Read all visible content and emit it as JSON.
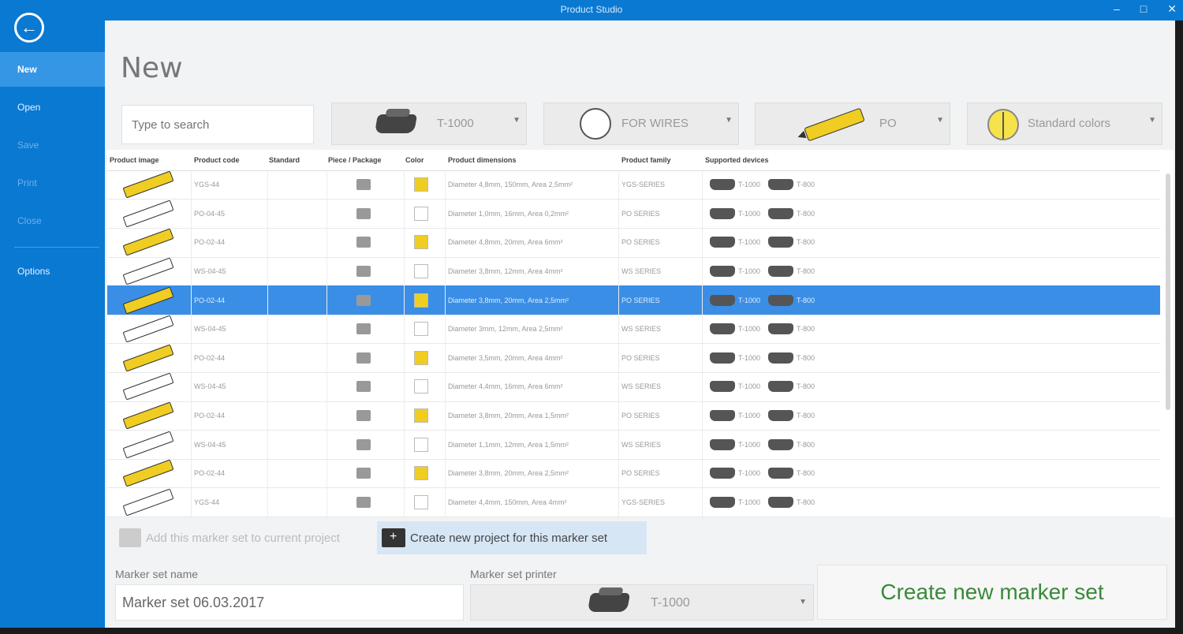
{
  "window": {
    "title": "Product Studio"
  },
  "sidebar": {
    "items": [
      {
        "label": "New",
        "state": "selected"
      },
      {
        "label": "Open",
        "state": "normal"
      },
      {
        "label": "Save",
        "state": "dim"
      },
      {
        "label": "Print",
        "state": "dim"
      },
      {
        "label": "Close",
        "state": "dim"
      },
      {
        "label": "Options",
        "state": "normal"
      }
    ]
  },
  "page": {
    "title": "New"
  },
  "search": {
    "placeholder": "Type to search"
  },
  "filters": {
    "device": "T-1000",
    "wire": "FOR WIRES",
    "marker": "PO",
    "colors": "Standard colors"
  },
  "grid": {
    "headers": [
      "Product image",
      "Product code",
      "Standard",
      "Piece / Package",
      "Color",
      "Product dimensions",
      "Product family",
      "Supported devices"
    ],
    "rows": [
      {
        "marker": "yellow",
        "code": "YGS-44",
        "color": "#f0cd22",
        "dims": "Diameter 4,8mm, 150mm, Area 2,5mm²",
        "family": "YGS-SERIES",
        "dev1": "T-1000",
        "dev2": "T-800"
      },
      {
        "marker": "white",
        "code": "PO-04-45",
        "color": "#ffffff",
        "dims": "Diameter 1,0mm, 16mm, Area 0,2mm²",
        "family": "PO SERIES",
        "dev1": "T-1000",
        "dev2": "T-800"
      },
      {
        "marker": "yellow",
        "code": "PO-02-44",
        "color": "#f0cd22",
        "dims": "Diameter 4,8mm, 20mm, Area 6mm²",
        "family": "PO SERIES",
        "dev1": "T-1000",
        "dev2": "T-800"
      },
      {
        "marker": "white",
        "code": "WS-04-45",
        "color": "#ffffff",
        "dims": "Diameter 3,8mm, 12mm, Area 4mm²",
        "family": "WS SERIES",
        "dev1": "T-1000",
        "dev2": "T-800"
      },
      {
        "marker": "yellow",
        "code": "PO-02-44",
        "color": "#f0cd22",
        "dims": "Diameter 3,8mm, 20mm, Area 2,5mm²",
        "family": "PO SERIES",
        "dev1": "T-1000",
        "dev2": "T-800",
        "selected": true
      },
      {
        "marker": "white",
        "code": "WS-04-45",
        "color": "#ffffff",
        "dims": "Diameter 3mm, 12mm, Area 2,5mm²",
        "family": "WS SERIES",
        "dev1": "T-1000",
        "dev2": "T-800"
      },
      {
        "marker": "yellow",
        "code": "PO-02-44",
        "color": "#f0cd22",
        "dims": "Diameter 3,5mm, 20mm, Area 4mm²",
        "family": "PO SERIES",
        "dev1": "T-1000",
        "dev2": "T-800"
      },
      {
        "marker": "white",
        "code": "WS-04-45",
        "color": "#ffffff",
        "dims": "Diameter 4,4mm, 16mm, Area 6mm²",
        "family": "WS SERIES",
        "dev1": "T-1000",
        "dev2": "T-800"
      },
      {
        "marker": "yellow",
        "code": "PO-02-44",
        "color": "#f0cd22",
        "dims": "Diameter 3,8mm, 20mm, Area 1,5mm²",
        "family": "PO SERIES",
        "dev1": "T-1000",
        "dev2": "T-800"
      },
      {
        "marker": "white",
        "code": "WS-04-45",
        "color": "#ffffff",
        "dims": "Diameter 1,1mm, 12mm, Area 1,5mm²",
        "family": "WS SERIES",
        "dev1": "T-1000",
        "dev2": "T-800"
      },
      {
        "marker": "yellow",
        "code": "PO-02-44",
        "color": "#f0cd22",
        "dims": "Diameter 3,8mm, 20mm, Area 2,5mm²",
        "family": "PO SERIES",
        "dev1": "T-1000",
        "dev2": "T-800"
      },
      {
        "marker": "white",
        "code": "YGS-44",
        "color": "#ffffff",
        "dims": "Diameter 4,4mm, 150mm, Area 4mm²",
        "family": "YGS-SERIES",
        "dev1": "T-1000",
        "dev2": "T-800"
      }
    ]
  },
  "actions": {
    "add_label": "Add this marker set to current project",
    "create_project_label": "Create new project for this marker set"
  },
  "form": {
    "name_label": "Marker set name",
    "name_value": "Marker set 06.03.2017",
    "device_label": "Marker set printer",
    "device_value": "T-1000",
    "create_button": "Create new marker set"
  }
}
